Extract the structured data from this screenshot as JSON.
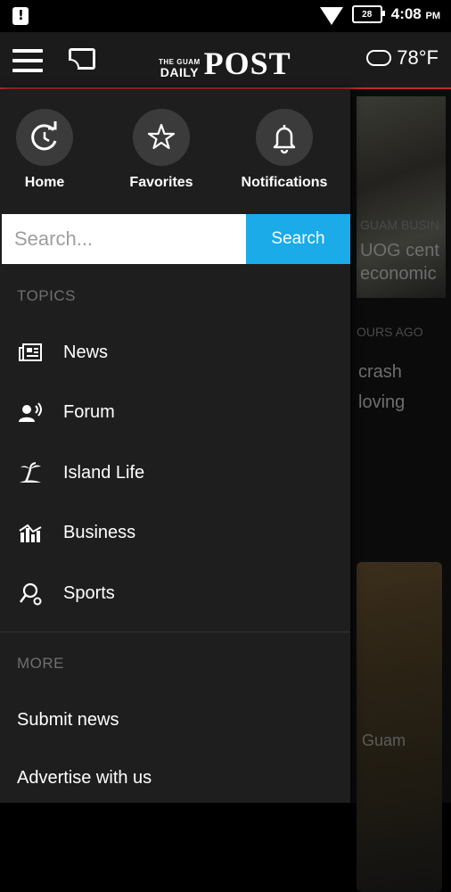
{
  "status": {
    "battery": "28",
    "time": "4:08",
    "ampm": "PM"
  },
  "appbar": {
    "logo_small_top": "THE GUAM",
    "logo_small_bottom": "DAILY",
    "logo_big": "POST",
    "temperature": "78°F"
  },
  "quick_actions": [
    {
      "label": "Home",
      "icon": "refresh-home-icon"
    },
    {
      "label": "Favorites",
      "icon": "star-icon"
    },
    {
      "label": "Notifications",
      "icon": "bell-icon"
    }
  ],
  "search": {
    "placeholder": "Search...",
    "button": "Search"
  },
  "topics": {
    "heading": "TOPICS",
    "items": [
      {
        "label": "News",
        "icon": "newspaper-icon"
      },
      {
        "label": "Forum",
        "icon": "forum-icon"
      },
      {
        "label": "Island Life",
        "icon": "palm-tree-icon"
      },
      {
        "label": "Business",
        "icon": "business-chart-icon"
      },
      {
        "label": "Sports",
        "icon": "sports-icon"
      }
    ]
  },
  "more": {
    "heading": "MORE",
    "items": [
      {
        "label": "Submit news"
      },
      {
        "label": "Advertise with us"
      }
    ]
  },
  "background": {
    "caption1": "GUAM BUSIN",
    "headline1a": "UOG cent",
    "headline1b": "economic",
    "caption2": "OURS AGO",
    "headline2a": "crash",
    "headline2b": "loving",
    "caption3": "Guam"
  }
}
